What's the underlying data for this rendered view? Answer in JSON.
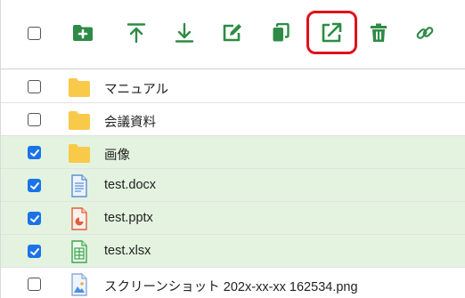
{
  "toolbar": {
    "icons": [
      {
        "name": "new-folder-icon"
      },
      {
        "name": "upload-icon"
      },
      {
        "name": "download-icon"
      },
      {
        "name": "rename-icon"
      },
      {
        "name": "copy-icon"
      },
      {
        "name": "open-external-icon"
      },
      {
        "name": "delete-icon"
      },
      {
        "name": "link-icon"
      }
    ],
    "highlighted_icon": "open-external-icon"
  },
  "files": [
    {
      "name": "マニュアル",
      "type": "folder",
      "checked": false
    },
    {
      "name": "会議資料",
      "type": "folder",
      "checked": false
    },
    {
      "name": "画像",
      "type": "folder",
      "checked": true
    },
    {
      "name": "test.docx",
      "type": "docx",
      "checked": true
    },
    {
      "name": "test.pptx",
      "type": "pptx",
      "checked": true
    },
    {
      "name": "test.xlsx",
      "type": "xlsx",
      "checked": true
    },
    {
      "name": "スクリーンショット 202x-xx-xx 162534.png",
      "type": "png",
      "checked": false
    }
  ],
  "colors": {
    "accent_green": "#2e8b45",
    "selected_row": "#e3f3df",
    "checkbox_blue": "#1a73e8",
    "highlight_red": "#e0101a",
    "folder_yellow": "#f9c94a"
  }
}
